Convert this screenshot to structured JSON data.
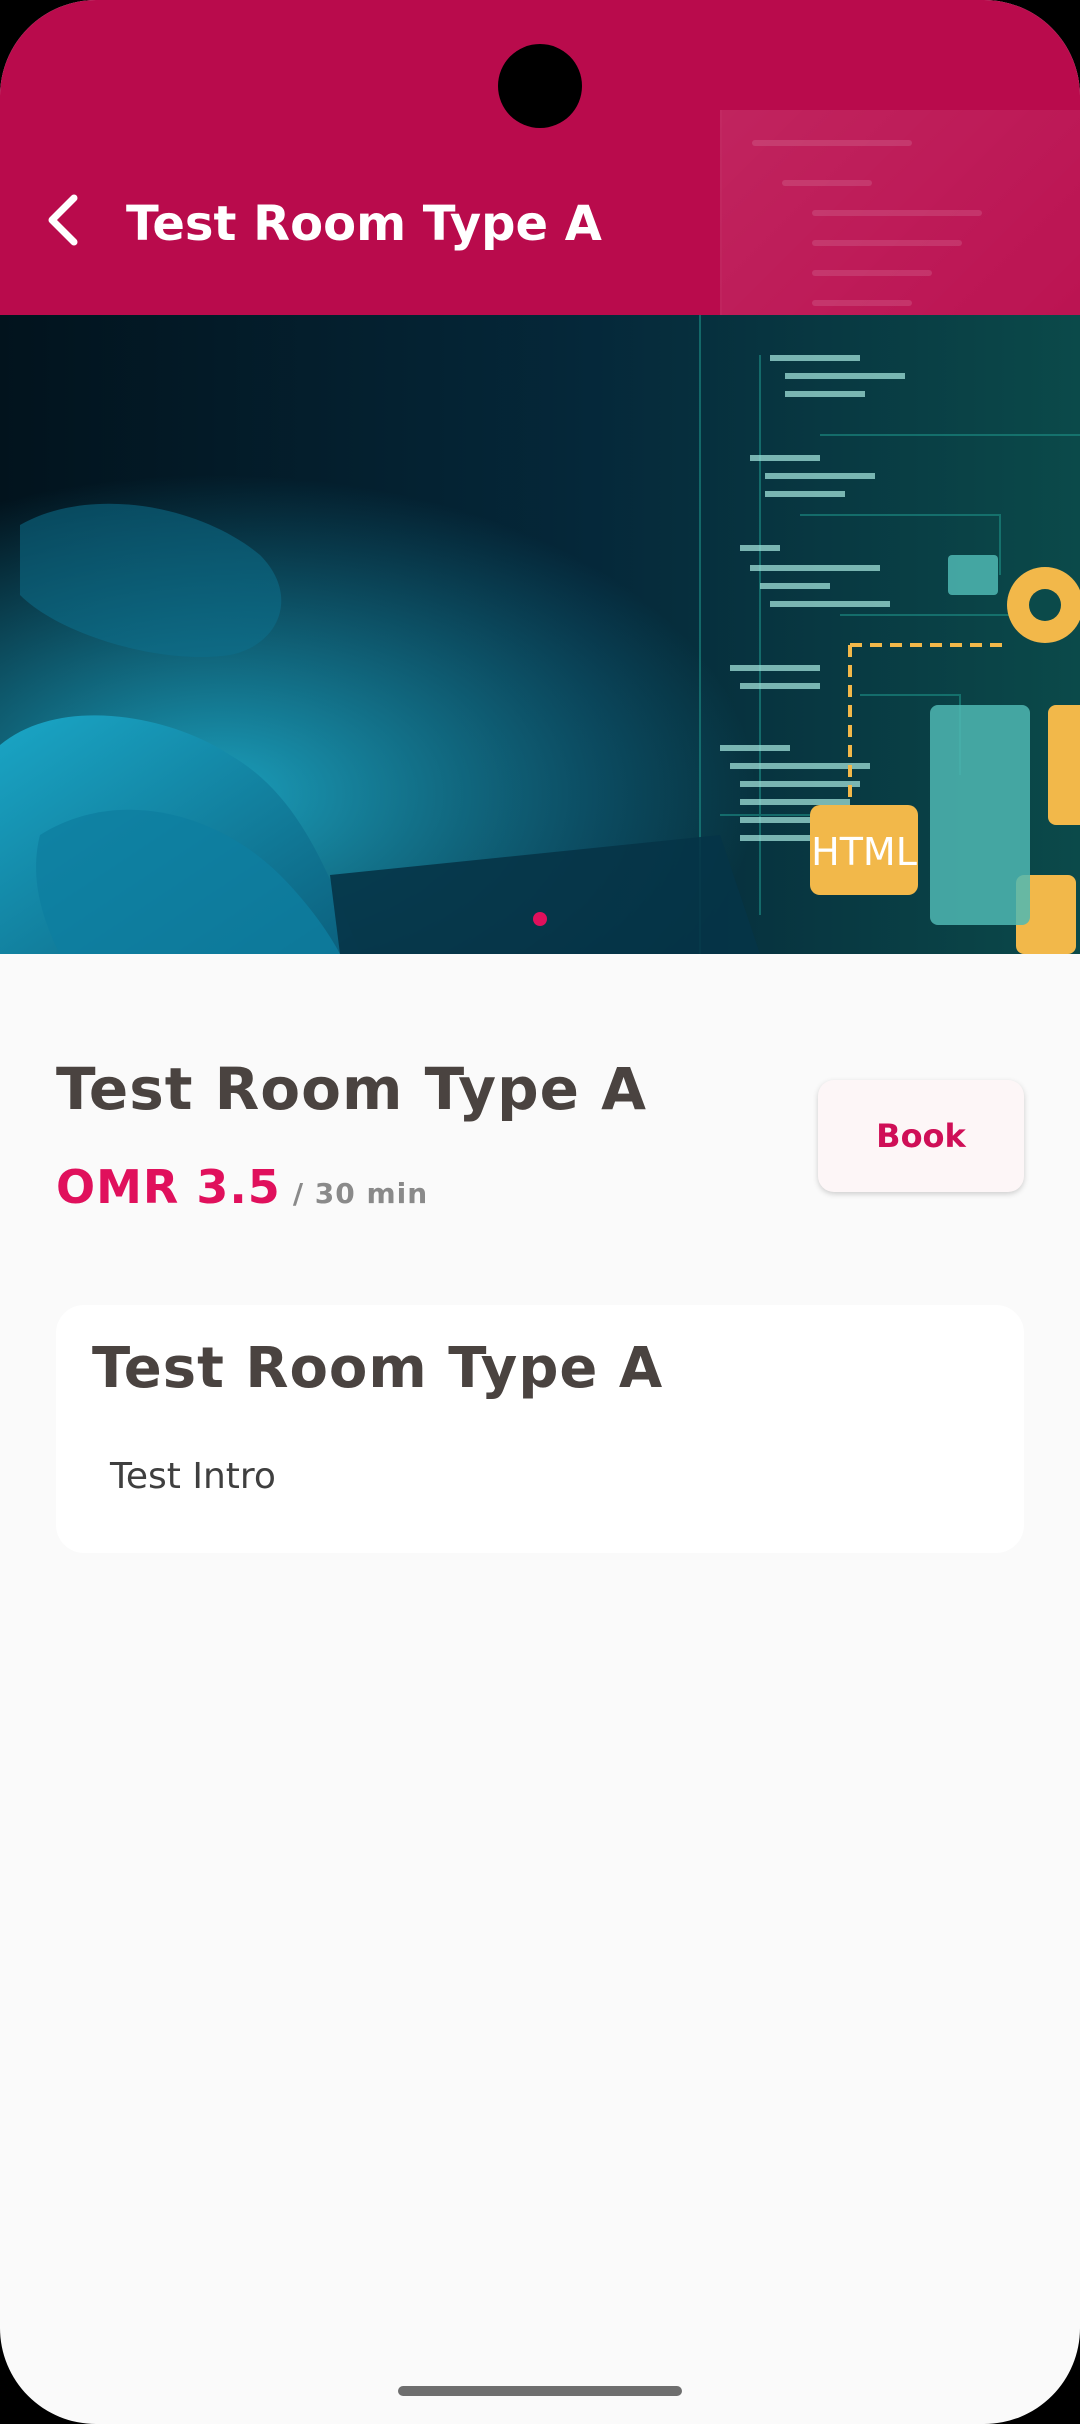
{
  "app_bar": {
    "title": "Test Room Type A",
    "back_icon": "chevron-left-icon",
    "background_color": "#b90b4c"
  },
  "carousel": {
    "image_description_icon": "coding-hero-image",
    "image_text": "HTML",
    "page_count": 1,
    "active_page": 1,
    "indicator_color": "#e0105c"
  },
  "room": {
    "title": "Test Room Type A",
    "price": "OMR 3.5",
    "per_unit": "/ 30 min",
    "price_color": "#e0105c"
  },
  "book_button": {
    "label": "Book",
    "color": "#cf0f57"
  },
  "info_card": {
    "title": "Test Room Type A",
    "intro": "Test Intro"
  }
}
